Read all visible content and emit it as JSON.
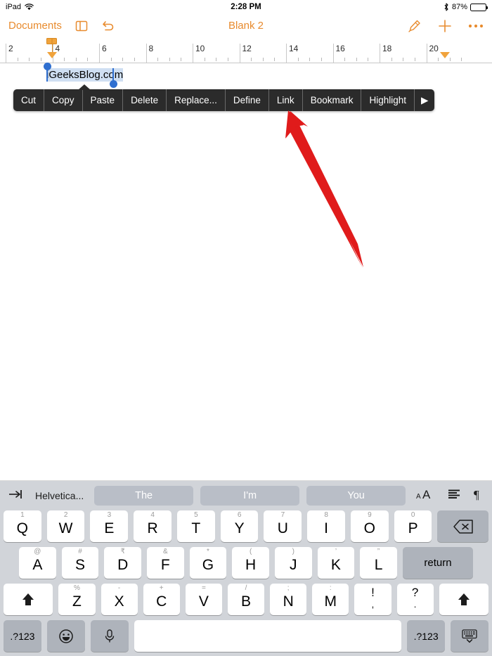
{
  "statusbar": {
    "device_label": "iPad",
    "wifi_icon": "wifi-icon",
    "time": "2:28 PM",
    "bluetooth_icon": "bluetooth-icon",
    "battery_percent": "87%",
    "battery_level": 87
  },
  "navbar": {
    "back_label": "Documents",
    "sidebar_icon": "layout-panel-icon",
    "undo_icon": "undo-arrow-icon",
    "title": "Blank 2",
    "highlighter_icon": "highlighter-pen-icon",
    "add_icon": "plus-icon",
    "more_icon": "more-ellipsis-icon",
    "accent_color": "#e88b2e"
  },
  "ruler": {
    "labels": [
      "2",
      "4",
      "6",
      "8",
      "10",
      "12",
      "14",
      "16",
      "18",
      "20"
    ],
    "left_indent_marker": "left-indent-marker",
    "right_indent_marker": "right-indent-marker",
    "marker_color": "#f0a33c"
  },
  "document": {
    "selected_text": "iGeeksBlog.com",
    "selection_color": "#cfdff2",
    "handle_color": "#2f6fd0"
  },
  "context_menu": {
    "items": [
      {
        "label": "Cut",
        "name": "cut"
      },
      {
        "label": "Copy",
        "name": "copy"
      },
      {
        "label": "Paste",
        "name": "paste"
      },
      {
        "label": "Delete",
        "name": "delete"
      },
      {
        "label": "Replace...",
        "name": "replace"
      },
      {
        "label": "Define",
        "name": "define"
      },
      {
        "label": "Link",
        "name": "link"
      },
      {
        "label": "Bookmark",
        "name": "bookmark"
      },
      {
        "label": "Highlight",
        "name": "highlight"
      }
    ],
    "next_arrow": "▶",
    "background_color": "#2b2b2b"
  },
  "annotation": {
    "arrow_color": "#e01b1b",
    "points_at": "Link"
  },
  "keyboard": {
    "toolbar": {
      "tab_icon": "tab-indent-icon",
      "font_name": "Helvetica...",
      "predictions": [
        "The",
        "I'm",
        "You"
      ],
      "font_size_icon": "font-size-icon",
      "align_icon": "text-align-icon",
      "paragraph_icon": "pilcrow-icon"
    },
    "row1": [
      {
        "main": "Q",
        "alt": "1"
      },
      {
        "main": "W",
        "alt": "2"
      },
      {
        "main": "E",
        "alt": "3"
      },
      {
        "main": "R",
        "alt": "4"
      },
      {
        "main": "T",
        "alt": "5"
      },
      {
        "main": "Y",
        "alt": "6"
      },
      {
        "main": "U",
        "alt": "7"
      },
      {
        "main": "I",
        "alt": "8"
      },
      {
        "main": "O",
        "alt": "9"
      },
      {
        "main": "P",
        "alt": "0"
      }
    ],
    "backspace_icon": "backspace-icon",
    "row2": [
      {
        "main": "A",
        "alt": "@"
      },
      {
        "main": "S",
        "alt": "#"
      },
      {
        "main": "D",
        "alt": "₹"
      },
      {
        "main": "F",
        "alt": "&"
      },
      {
        "main": "G",
        "alt": "*"
      },
      {
        "main": "H",
        "alt": "("
      },
      {
        "main": "J",
        "alt": ")"
      },
      {
        "main": "K",
        "alt": "’"
      },
      {
        "main": "L",
        "alt": "”"
      }
    ],
    "return_label": "return",
    "row3": [
      {
        "main": "Z",
        "alt": "%"
      },
      {
        "main": "X",
        "alt": "-"
      },
      {
        "main": "C",
        "alt": "+"
      },
      {
        "main": "V",
        "alt": "="
      },
      {
        "main": "B",
        "alt": "/"
      },
      {
        "main": "N",
        "alt": ";"
      },
      {
        "main": "M",
        "alt": ":"
      }
    ],
    "shift_icon": "shift-arrow-icon",
    "punct1": {
      "alt": "!",
      "main": ","
    },
    "punct2": {
      "alt": "?",
      "main": "."
    },
    "bottom": {
      "numeric_left": ".?123",
      "emoji_icon": "emoji-smiley-icon",
      "mic_icon": "microphone-icon",
      "space_label": "",
      "numeric_right": ".?123",
      "dismiss_icon": "dismiss-keyboard-icon"
    }
  }
}
